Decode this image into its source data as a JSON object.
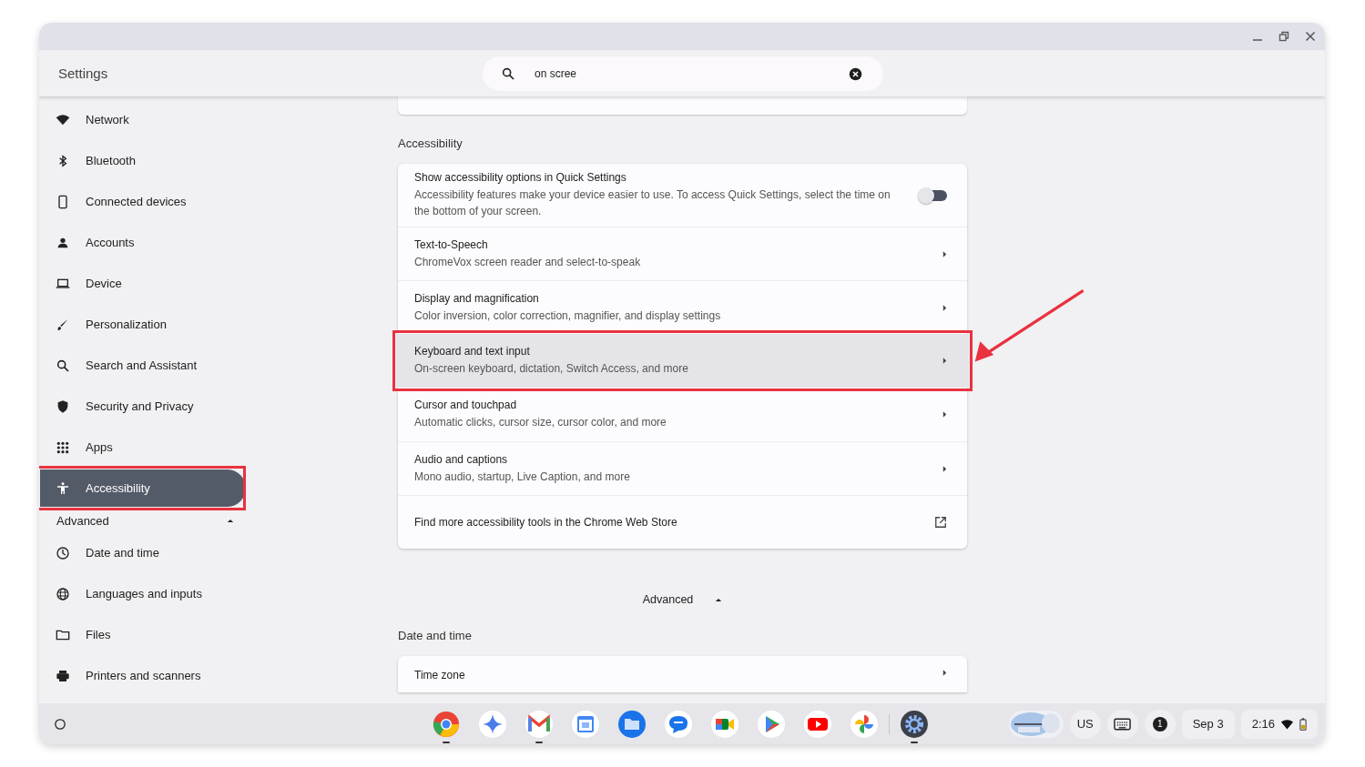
{
  "window": {
    "title": "Settings"
  },
  "search": {
    "value": "on scree"
  },
  "sidebar": {
    "items": [
      {
        "label": "Network",
        "selected": false,
        "highlighted": false
      },
      {
        "label": "Bluetooth",
        "selected": false,
        "highlighted": false
      },
      {
        "label": "Connected devices",
        "selected": false,
        "highlighted": false
      },
      {
        "label": "Accounts",
        "selected": false,
        "highlighted": false
      },
      {
        "label": "Device",
        "selected": false,
        "highlighted": false
      },
      {
        "label": "Personalization",
        "selected": false,
        "highlighted": false
      },
      {
        "label": "Search and Assistant",
        "selected": false,
        "highlighted": false
      },
      {
        "label": "Security and Privacy",
        "selected": false,
        "highlighted": false
      },
      {
        "label": "Apps",
        "selected": false,
        "highlighted": false
      },
      {
        "label": "Accessibility",
        "selected": true,
        "highlighted": true
      }
    ],
    "advanced": {
      "label": "Advanced",
      "expanded": true
    },
    "advanced_items": [
      {
        "label": "Date and time",
        "selected": false,
        "highlighted": false
      },
      {
        "label": "Languages and inputs",
        "selected": false,
        "highlighted": false
      },
      {
        "label": "Files",
        "selected": false,
        "highlighted": false
      },
      {
        "label": "Printers and scanners",
        "selected": false,
        "highlighted": false
      }
    ]
  },
  "sections": [
    {
      "title": "Accessibility",
      "rows": [
        {
          "kind": "toggle",
          "title": "Show accessibility options in Quick Settings",
          "subtitle": "Accessibility features make your device easier to use. To access Quick Settings, select the time on the bottom of your screen.",
          "checked": false,
          "highlighted": false
        },
        {
          "kind": "link",
          "title": "Text-to-Speech",
          "subtitle": "ChromeVox screen reader and select-to-speak",
          "highlighted": false
        },
        {
          "kind": "link",
          "title": "Display and magnification",
          "subtitle": "Color inversion, color correction, magnifier, and display settings",
          "highlighted": false
        },
        {
          "kind": "link",
          "title": "Keyboard and text input",
          "subtitle": "On-screen keyboard, dictation, Switch Access, and more",
          "highlighted": true
        },
        {
          "kind": "link",
          "title": "Cursor and touchpad",
          "subtitle": "Automatic clicks, cursor size, cursor color, and more",
          "highlighted": false
        },
        {
          "kind": "link",
          "title": "Audio and captions",
          "subtitle": "Mono audio, startup, Live Caption, and more",
          "highlighted": false
        },
        {
          "kind": "external",
          "title": "Find more accessibility tools in the Chrome Web Store",
          "highlighted": false
        }
      ]
    }
  ],
  "advanced_toggle": {
    "label": "Advanced",
    "expanded": true
  },
  "date_section": {
    "title": "Date and time",
    "rows": [
      {
        "kind": "link",
        "title": "Time zone"
      }
    ]
  },
  "shelf": {
    "apps": [
      {
        "kind": "chrome",
        "open": true
      },
      {
        "kind": "gemini",
        "open": false
      },
      {
        "kind": "gmail",
        "open": true
      },
      {
        "kind": "calendar",
        "open": false
      },
      {
        "kind": "files",
        "open": false
      },
      {
        "kind": "messages",
        "open": false
      },
      {
        "kind": "meet",
        "open": false
      },
      {
        "kind": "play",
        "open": false
      },
      {
        "kind": "youtube",
        "open": false
      },
      {
        "kind": "photos",
        "open": false
      },
      {
        "kind": "settings",
        "open": true
      }
    ],
    "ime": "US",
    "notifications": "1",
    "date": "Sep 3",
    "time": "2:16"
  }
}
